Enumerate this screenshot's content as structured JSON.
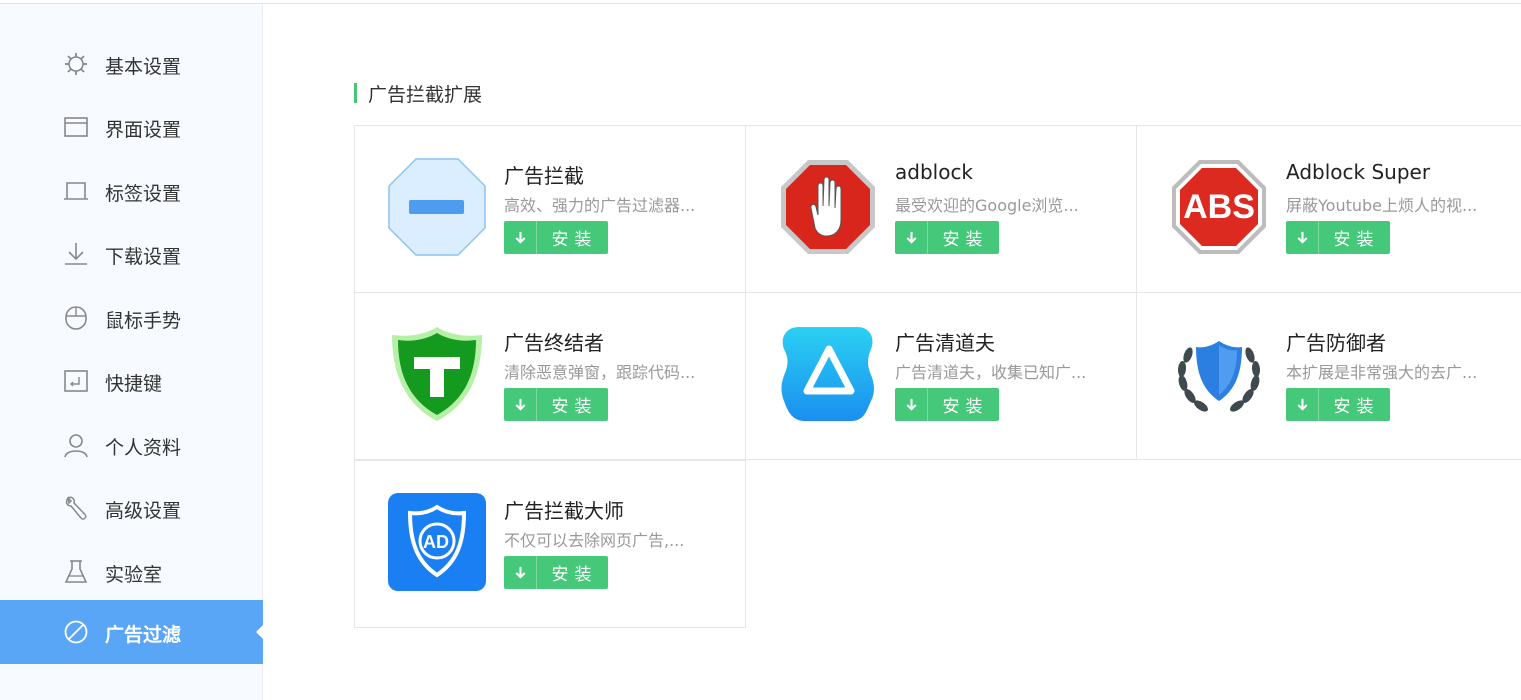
{
  "sidebar": {
    "items": [
      {
        "label": "基本设置",
        "icon": "gear-icon"
      },
      {
        "label": "界面设置",
        "icon": "window-icon"
      },
      {
        "label": "标签设置",
        "icon": "tab-icon"
      },
      {
        "label": "下载设置",
        "icon": "download-icon"
      },
      {
        "label": "鼠标手势",
        "icon": "mouse-icon"
      },
      {
        "label": "快捷键",
        "icon": "keyboard-icon"
      },
      {
        "label": "个人资料",
        "icon": "user-icon"
      },
      {
        "label": "高级设置",
        "icon": "wrench-icon"
      },
      {
        "label": "实验室",
        "icon": "flask-icon"
      },
      {
        "label": "广告过滤",
        "icon": "block-icon",
        "active": true
      }
    ]
  },
  "main": {
    "section_title": "广告拦截扩展",
    "install_label": "安装",
    "extensions": [
      {
        "name": "广告拦截",
        "desc": "高效、强力的广告过滤器...",
        "icon": "blue-octagon-minus-icon"
      },
      {
        "name": "adblock",
        "desc": "最受欢迎的Google浏览...",
        "icon": "red-stop-hand-icon"
      },
      {
        "name": "Adblock Super",
        "desc": "屏蔽Youtube上烦人的视...",
        "icon": "abs-stop-sign-icon",
        "logo_text": "ABS"
      },
      {
        "name": "广告终结者",
        "desc": "清除恶意弹窗，跟踪代码...",
        "icon": "green-shield-t-icon",
        "logo_text": "T"
      },
      {
        "name": "广告清道夫",
        "desc": "广告清道夫，收集已知广...",
        "icon": "blue-triangle-icon"
      },
      {
        "name": "广告防御者",
        "desc": "本扩展是非常强大的去广...",
        "icon": "laurel-shield-icon"
      },
      {
        "name": "广告拦截大师",
        "desc": "不仅可以去除网页广告,...",
        "icon": "ad-shield-icon",
        "logo_text": "AD"
      }
    ]
  },
  "colors": {
    "accent_green": "#46c87a",
    "sidebar_active": "#5aa6f6",
    "sidebar_bg": "#f7fbff"
  }
}
